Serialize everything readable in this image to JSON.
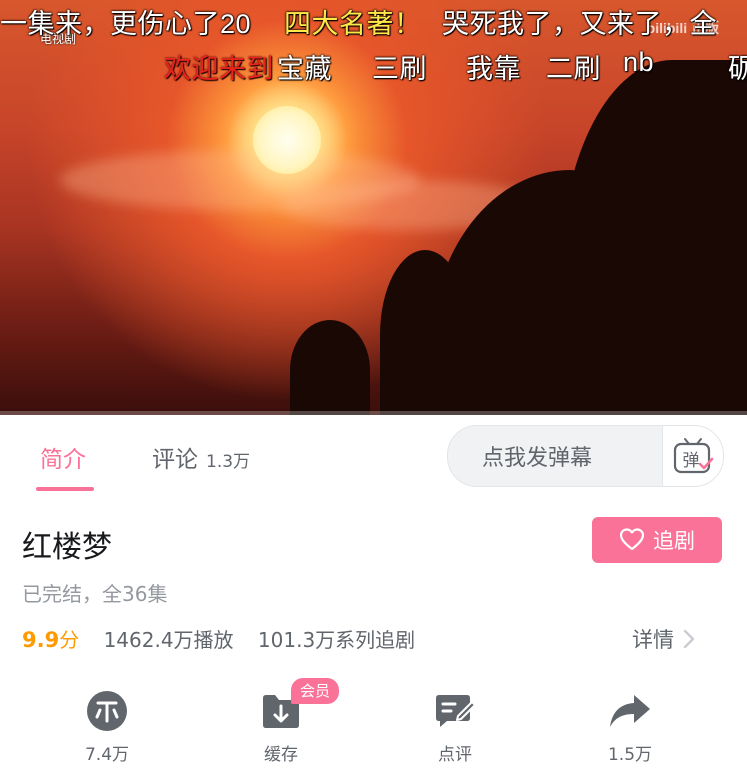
{
  "video": {
    "channel_logo": "电视剧",
    "watermark": "bilibili 正版",
    "danmaku": [
      "一集来，更伤心了20",
      "四大名著！",
      "哭死我了，又来了，全",
      "欢迎来到",
      "宝藏",
      "三刷",
      "我靠",
      "二刷",
      "nb",
      "砺"
    ],
    "progress": 0.0
  },
  "tabs": [
    {
      "label": "简介",
      "active": true
    },
    {
      "label": "评论",
      "count": "1.3万",
      "active": false
    }
  ],
  "danmaku_input": {
    "placeholder": "点我发弹幕",
    "toggle_icon": "danmaku-toggle-icon",
    "toggle_text": "弹"
  },
  "info": {
    "title": "红楼梦",
    "follow_label": "追剧",
    "status": "已完结，全36集",
    "score": "9.9",
    "score_unit": "分",
    "plays": "1462.4万播放",
    "series_follows": "101.3万系列追剧",
    "detail_label": "详情"
  },
  "actions": [
    {
      "name": "coin",
      "label": "7.4万",
      "icon": "coin-icon"
    },
    {
      "name": "download",
      "label": "缓存",
      "icon": "download-icon",
      "badge": "会员"
    },
    {
      "name": "review",
      "label": "点评",
      "icon": "review-icon"
    },
    {
      "name": "share",
      "label": "1.5万",
      "icon": "share-icon"
    }
  ],
  "colors": {
    "accent": "#fb7299",
    "score": "#ff9a00",
    "text_secondary": "#61666d",
    "text_muted": "#9499a0"
  }
}
